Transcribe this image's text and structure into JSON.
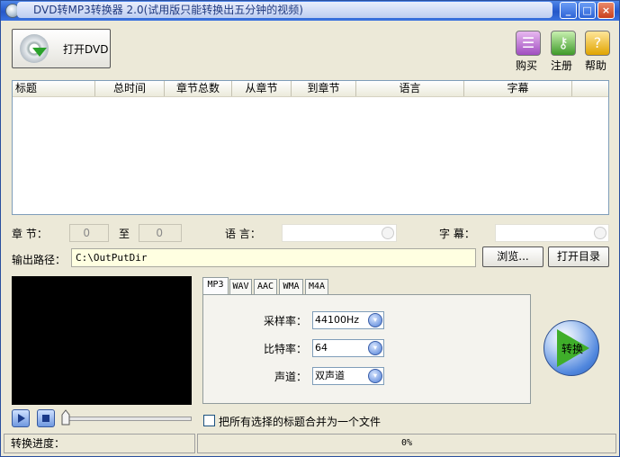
{
  "window": {
    "title": "DVD转MP3转换器 2.0(试用版只能转换出五分钟的视频)",
    "minimize_glyph": "_",
    "maximize_glyph": "□",
    "close_glyph": "×"
  },
  "toolbar": {
    "open_dvd": "打开DVD",
    "buy": "购买",
    "register": "注册",
    "help": "帮助",
    "help_glyph": "?"
  },
  "list": {
    "columns": [
      "标题",
      "总时间",
      "章节总数",
      "从章节",
      "到章节",
      "语言",
      "字幕"
    ]
  },
  "chapter": {
    "label": "章    节：",
    "from_value": "0",
    "to_label": "至",
    "to_value": "0"
  },
  "language": {
    "label": "语    言："
  },
  "subtitle": {
    "label": "字    幕："
  },
  "output": {
    "label": "输出路径：",
    "path": "C:\\OutPutDir",
    "browse": "浏览...",
    "open_dir": "打开目录"
  },
  "tabs": [
    "MP3",
    "WAV",
    "AAC",
    "WMA",
    "M4A"
  ],
  "settings": {
    "sample_rate_label": "采样率：",
    "sample_rate_value": "44100Hz",
    "bit_rate_label": "比特率：",
    "bit_rate_value": "64",
    "channel_label": "声道：",
    "channel_value": "双声道"
  },
  "convert_label": "转换",
  "merge_label": "把所有选择的标题合并为一个文件",
  "status": {
    "progress_label": "转换进度：",
    "progress_text": "0%",
    "progress_value": 0
  },
  "colors": {
    "titlebar": "#2a5fd0",
    "window_bg": "#ece9d8",
    "path_bg": "#ffffe1",
    "convert_arrow": "#3fae2a"
  },
  "icons": [
    "disc-icon",
    "cart-icon",
    "key-icon",
    "help-icon",
    "play-icon",
    "stop-icon",
    "convert-icon"
  ]
}
